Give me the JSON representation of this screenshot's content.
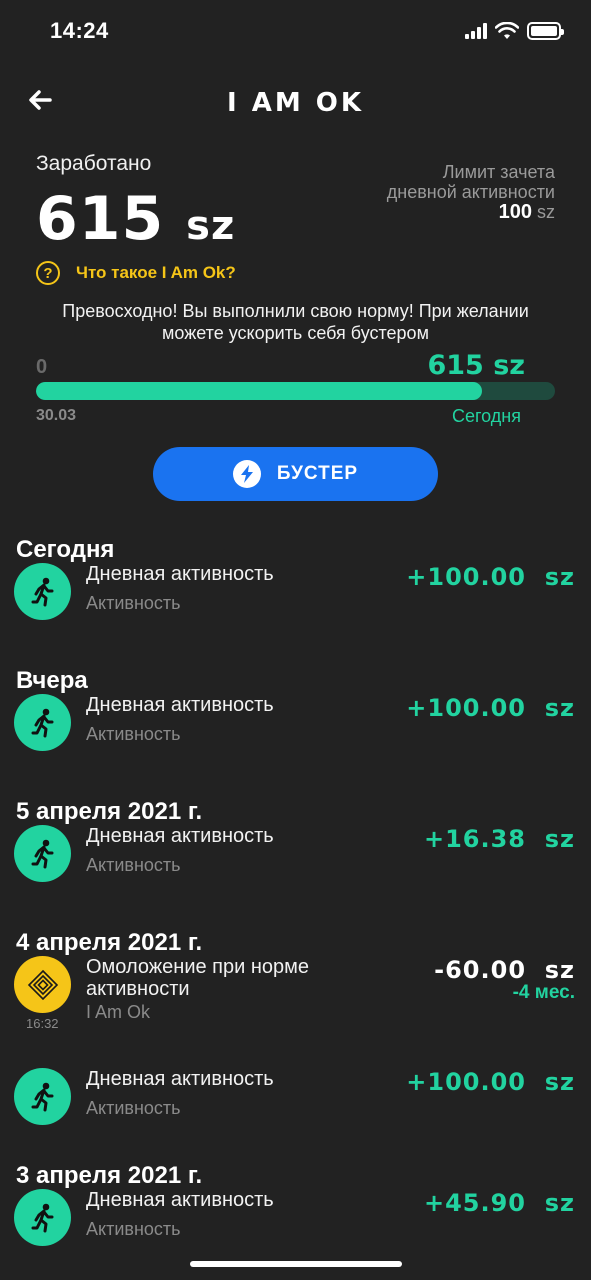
{
  "status_bar": {
    "time": "14:24"
  },
  "header": {
    "title": "I AM OK",
    "back_icon": "arrow-left-icon"
  },
  "summary": {
    "earned_label": "Заработано",
    "earned_value": "615",
    "earned_unit": "sz",
    "limit_label_line1": "Лимит зачета",
    "limit_label_line2": "дневной активности",
    "limit_value": "100",
    "limit_unit": "sz"
  },
  "help": {
    "label": "Что такое I Am Ok?",
    "icon": "question-circle-icon"
  },
  "message": "Превосходно! Вы выполнили свою норму! При желании можете ускорить себя бустером",
  "progress": {
    "start_label": "0",
    "amount_label": "615 sz",
    "start_date": "30.03",
    "end_label": "Сегодня",
    "fraction": 0.86
  },
  "booster": {
    "label": "БУСТЕР",
    "icon": "lightning-icon"
  },
  "colors": {
    "accent": "#22d3a0",
    "booster": "#1a73f0",
    "gold": "#f5c518",
    "background": "#222222"
  },
  "sections": [
    {
      "title": "Сегодня",
      "items": [
        {
          "title": "Дневная активность",
          "subtitle": "Активность",
          "amount": "+100.00",
          "unit": "sz",
          "icon": "running-person-icon"
        }
      ]
    },
    {
      "title": "Вчера",
      "items": [
        {
          "title": "Дневная активность",
          "subtitle": "Активность",
          "amount": "+100.00",
          "unit": "sz",
          "icon": "running-person-icon"
        }
      ]
    },
    {
      "title": "5 апреля 2021 г.",
      "items": [
        {
          "title": "Дневная активность",
          "subtitle": "Активность",
          "amount": "+16.38",
          "unit": "sz",
          "icon": "running-person-icon"
        }
      ]
    },
    {
      "title": "4 апреля 2021 г.",
      "items": [
        {
          "title": "Омоложение при норме активности",
          "subtitle": "I Am Ok",
          "amount": "-60.00",
          "unit": "sz",
          "extra": "-4 мес.",
          "time": "16:32",
          "icon": "i-am-ok-logo-icon"
        },
        {
          "title": "Дневная активность",
          "subtitle": "Активность",
          "amount": "+100.00",
          "unit": "sz",
          "icon": "running-person-icon"
        }
      ]
    },
    {
      "title": "3 апреля 2021 г.",
      "items": [
        {
          "title": "Дневная активность",
          "subtitle": "Активность",
          "amount": "+45.90",
          "unit": "sz",
          "icon": "running-person-icon"
        }
      ]
    }
  ]
}
